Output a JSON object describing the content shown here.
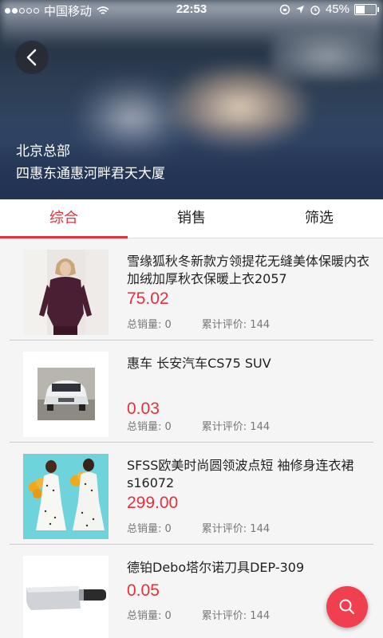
{
  "status_bar": {
    "carrier": "中国移动",
    "time": "22:53",
    "battery": "45%",
    "battery_level": 0.45
  },
  "header": {
    "store_name": "北京总部",
    "address": "四惠东通惠河畔君天大厦"
  },
  "tabs": [
    {
      "label": "综合",
      "active": true
    },
    {
      "label": "销售",
      "active": false
    },
    {
      "label": "筛选",
      "active": false
    }
  ],
  "products": [
    {
      "title": "雪缘狐秋冬新款方领提花无缝美体保暖内衣加绒加厚秋衣保暖上衣2057",
      "price": "75.02",
      "sales": "总销量: 0",
      "reviews": "累计评价: 144",
      "thumb": "sweater-photo"
    },
    {
      "title": "惠车 长安汽车CS75 SUV",
      "price": "0.03",
      "sales": "总销量: 0",
      "reviews": "累计评价: 144",
      "thumb": "car-photo"
    },
    {
      "title": "SFSS欧美时尚圆领波点短 袖修身连衣裙s16072",
      "price": "299.00",
      "sales": "总销量: 0",
      "reviews": "累计评价: 144",
      "thumb": "dress-photo"
    },
    {
      "title": "德铂Debo塔尔诺刀具DEP-309",
      "price": "0.05",
      "sales": "总销量: 0",
      "reviews": "累计评价: 144",
      "thumb": "knife-photo"
    }
  ],
  "colors": {
    "accent": "#e8303c",
    "fab": "#f0404f"
  },
  "icons": {
    "back": "chevron-left-icon",
    "fab": "search-icon"
  }
}
